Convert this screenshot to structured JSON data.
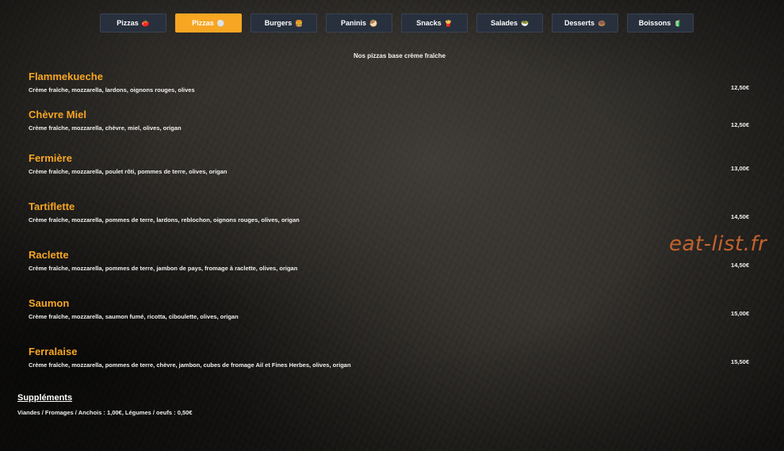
{
  "nav": {
    "tabs": [
      {
        "label": "Pizzas",
        "emoji": "🍅",
        "active": false
      },
      {
        "label": "Pizzas",
        "emoji": "⚪",
        "active": true
      },
      {
        "label": "Burgers",
        "emoji": "🍔",
        "active": false
      },
      {
        "label": "Paninis",
        "emoji": "🥙",
        "active": false
      },
      {
        "label": "Snacks",
        "emoji": "🍟",
        "active": false
      },
      {
        "label": "Salades",
        "emoji": "🥗",
        "active": false
      },
      {
        "label": "Desserts",
        "emoji": "🍩",
        "active": false
      },
      {
        "label": "Boissons",
        "emoji": "🧃",
        "active": false
      }
    ]
  },
  "menu": {
    "intro": "Nos pizzas base crème fraîche",
    "items": [
      {
        "name": "Flammekueche",
        "description": "Crème fraîche, mozzarella, lardons, oignons rouges, olives",
        "price": "12,50€"
      },
      {
        "name": "Chèvre Miel",
        "description": "Crème fraîche, mozzarella, chèvre, miel, olives, origan",
        "price": "12,50€"
      },
      {
        "name": "Fermière",
        "description": "Crème fraîche, mozzarella, poulet rôti, pommes de terre, olives, origan",
        "price": "13,00€"
      },
      {
        "name": "Tartiflette",
        "description": "Crème fraîche, mozzarella, pommes de terre, lardons, reblochon, oignons rouges, olives, origan",
        "price": "14,50€"
      },
      {
        "name": "Raclette",
        "description": "Crème fraîche, mozzarella, pommes de terre, jambon de pays, fromage à raclette, olives, origan",
        "price": "14,50€"
      },
      {
        "name": "Saumon",
        "description": "Crème fraîche, mozzarella, saumon fumé, ricotta, ciboulette, olives, origan",
        "price": "15,00€"
      },
      {
        "name": "Ferralaise",
        "description": "Crème fraîche, mozzarella, pommes de terre, chèvre, jambon, cubes de fromage Ail et Fines Herbes, olives, origan",
        "price": "15,50€"
      }
    ]
  },
  "supplements": {
    "title": "Suppléments",
    "text": "Viandes / Fromages / Anchois : 1,00€, Légumes / oeufs : 0,50€"
  },
  "watermark": "eat-list.fr",
  "colors": {
    "accent": "#f6a623",
    "tab_bg": "#28303d",
    "watermark": "#c4622d"
  }
}
